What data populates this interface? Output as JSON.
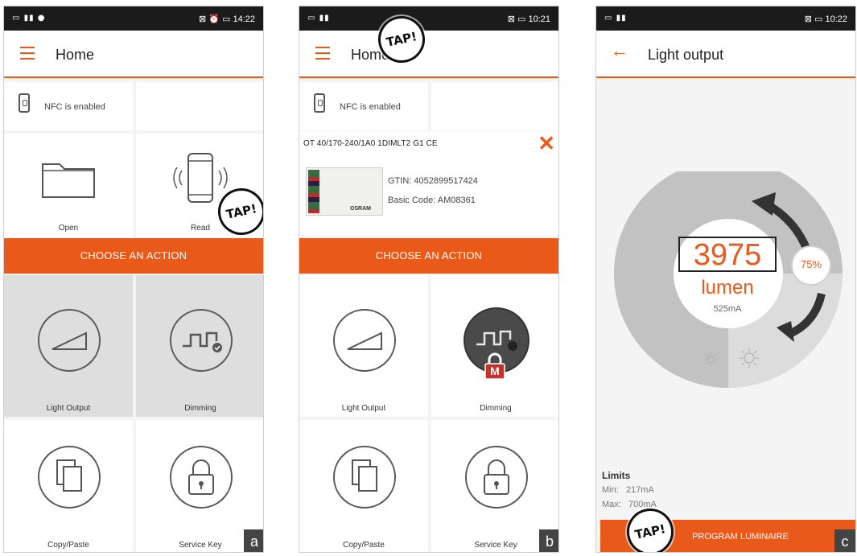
{
  "panels": {
    "a": {
      "status_right": "⊠ ⏰ ▭ 14:22",
      "title": "Home",
      "nfc_text": "NFC is enabled",
      "open_label": "Open",
      "read_label": "Read",
      "choose_action": "CHOOSE AN ACTION",
      "light_output_label": "Light Output",
      "dimming_label": "Dimming",
      "copy_paste_label": "Copy/Paste",
      "service_key_label": "Service Key",
      "tap_text": "TAP!",
      "corner": "a"
    },
    "b": {
      "status_right": "⊠ ▭ 10:21",
      "title": "Home",
      "nfc_text": "NFC is enabled",
      "device_title": "OT 40/170-240/1A0 1DIMLT2 G1 CE",
      "gtin": "GTIN: 4052899517424",
      "basic_code": "Basic Code: AM08361",
      "device_brand": "OSRAM",
      "choose_action": "CHOOSE AN ACTION",
      "light_output_label": "Light Output",
      "dimming_label": "Dimming",
      "lock_letter": "M",
      "copy_paste_label": "Copy/Paste",
      "service_key_label": "Service Key",
      "tap_text": "TAP!",
      "corner": "b"
    },
    "c": {
      "status_right": "⊠ ▭ 10:22",
      "title": "Light output",
      "lumen_value": "3975",
      "lumen_unit": "lumen",
      "current": "525mA",
      "percent": "75%",
      "level": 0.75,
      "limits_title": "Limits",
      "min_label": "Min:",
      "min_value": "217mA",
      "max_label": "Max:",
      "max_value": "700mA",
      "program_button": "PROGRAM LUMINAIRE",
      "tap_text": "TAP!",
      "corner": "c"
    }
  },
  "colors": {
    "accent": "#e8591a",
    "statusbar": "#1b1b1b"
  },
  "icons": [
    "menu-icon",
    "nfc-phone-icon",
    "folder-icon",
    "phone-read-icon",
    "light-output-icon",
    "dimming-icon",
    "copy-icon",
    "padlock-icon",
    "back-arrow-icon",
    "sun-icon",
    "close-icon"
  ]
}
